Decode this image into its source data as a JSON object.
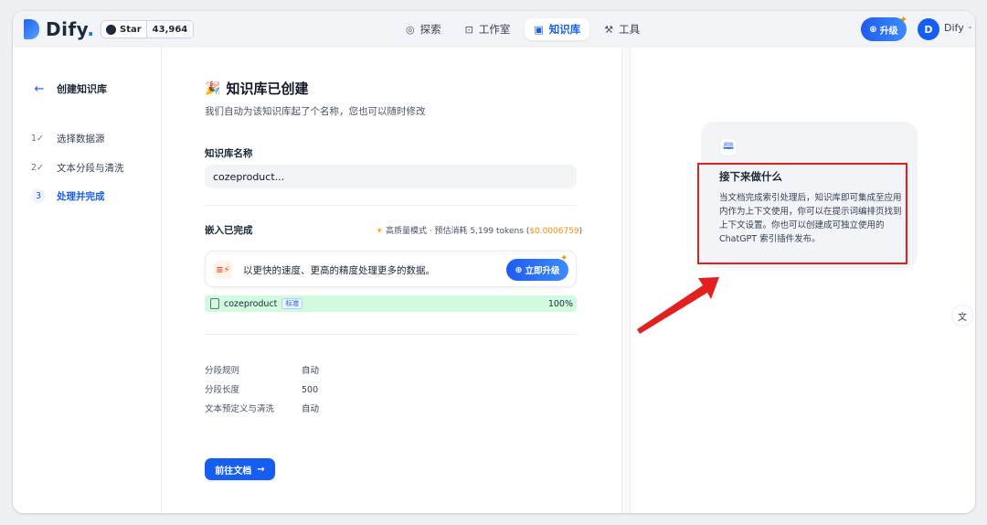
{
  "header": {
    "brand": "Dify",
    "brand_dot": ".",
    "github": {
      "label": "Star",
      "count": "43,964"
    },
    "nav": [
      {
        "label": "探索",
        "icon": "compass-icon"
      },
      {
        "label": "工作室",
        "icon": "robot-icon"
      },
      {
        "label": "知识库",
        "icon": "book-icon",
        "active": true
      },
      {
        "label": "工具",
        "icon": "hammer-icon"
      }
    ],
    "upgrade_label": "升级",
    "user": {
      "initial": "D",
      "name": "Dify"
    }
  },
  "sidebar": {
    "title": "创建知识库",
    "steps": [
      {
        "num": "1",
        "label": "选择数据源",
        "done": true
      },
      {
        "num": "2",
        "label": "文本分段与清洗",
        "done": true
      },
      {
        "num": "3",
        "label": "处理并完成",
        "active": true
      }
    ]
  },
  "main": {
    "title": "知识库已创建",
    "subtitle": "我们自动为该知识库起了个名称，您也可以随时修改",
    "name_label": "知识库名称",
    "name_value": "cozeproduct...",
    "embed_title": "嵌入已完成",
    "quality_text": "高质量模式 · 预估消耗 5,199 tokens (",
    "quality_price": "$0.0006759",
    "quality_close": ")",
    "promo_text": "以更快的速度、更高的精度处理更多的数据。",
    "promo_button": "立即升级",
    "file": {
      "name": "cozeproduct",
      "badge": "标准",
      "progress": "100%"
    },
    "settings": [
      {
        "key": "分段规则",
        "value": "自动"
      },
      {
        "key": "分段长度",
        "value": "500"
      },
      {
        "key": "文本预定义与清洗",
        "value": "自动"
      }
    ],
    "doc_button": "前往文档"
  },
  "right_panel": {
    "card_title": "接下来做什么",
    "card_body": "当文档完成索引处理后，知识库即可集成至应用内作为上下文使用，你可以在提示词编排页找到上下文设置。你也可以创建成可独立使用的 ChatGPT 索引插件发布。",
    "lang_label": "文"
  },
  "colors": {
    "accent": "#155eef",
    "annotation": "#e32020",
    "warning": "#f79009",
    "success_bg": "#d1fadf"
  }
}
